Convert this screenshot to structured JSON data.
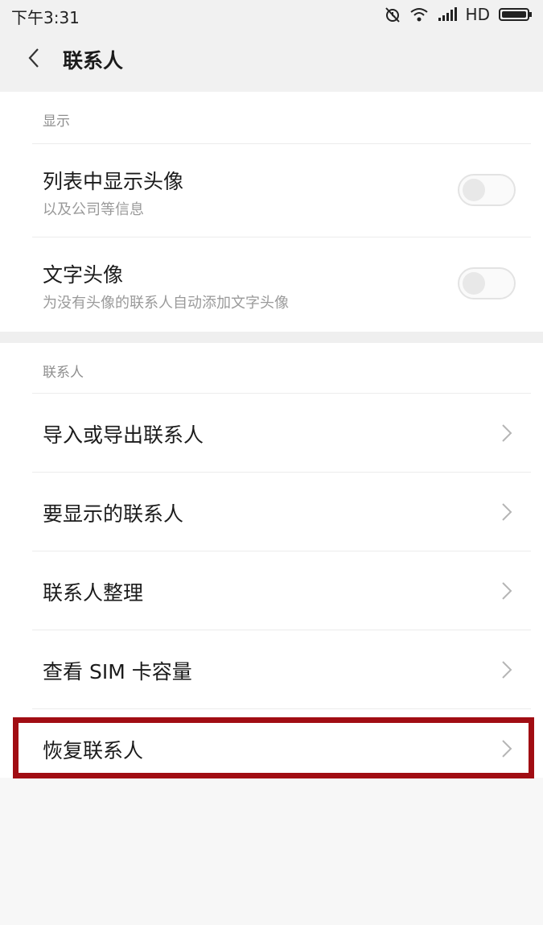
{
  "status_bar": {
    "time": "下午3:31",
    "network": "HD"
  },
  "header": {
    "back_icon": "chevron-left-icon",
    "title": "联系人"
  },
  "display_section": {
    "header": "显示",
    "items": [
      {
        "title": "列表中显示头像",
        "subtitle": "以及公司等信息",
        "toggle_on": false
      },
      {
        "title": "文字头像",
        "subtitle": "为没有头像的联系人自动添加文字头像",
        "toggle_on": false
      }
    ]
  },
  "contacts_section": {
    "header": "联系人",
    "items": [
      {
        "label": "导入或导出联系人"
      },
      {
        "label": "要显示的联系人"
      },
      {
        "label": "联系人整理"
      },
      {
        "label": "查看 SIM 卡容量"
      },
      {
        "label": "恢复联系人",
        "highlighted": true
      }
    ]
  },
  "colors": {
    "highlight": "#a10d13",
    "background": "#f7f7f7",
    "card": "#ffffff"
  }
}
